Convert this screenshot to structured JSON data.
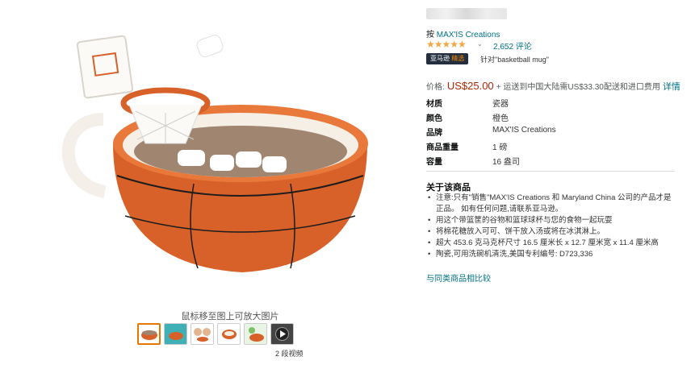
{
  "gallery": {
    "hint": "鼠标移至图上可放大图片",
    "videos_label": "2 段视频",
    "thumbnails": [
      "thumb-mug-front",
      "thumb-mug-lifestyle",
      "thumb-kids",
      "thumb-mug-top",
      "thumb-mug-alt",
      "thumb-video"
    ]
  },
  "product": {
    "brand_prefix": "按",
    "brand": "MAX'IS Creations",
    "rating_stars": "★★★★★",
    "rating_chevron": "⌄",
    "reviews": "2,652 评论",
    "badge_main": "亚马逊",
    "badge_highlight": "精选",
    "badge_for": "针对\"basketball mug\"",
    "price_label": "价格:",
    "price": "US$25.00",
    "shipping": "+ 运送到中国大陆需US$33.30配送和进口费用",
    "details_link": "详情",
    "specs": [
      {
        "key": "材质",
        "value": "瓷器"
      },
      {
        "key": "颜色",
        "value": "橙色"
      },
      {
        "key": "品牌",
        "value": "MAX'IS Creations"
      },
      {
        "key": "商品重量",
        "value": "1 磅"
      },
      {
        "key": "容量",
        "value": "16 盎司"
      }
    ],
    "about_title": "关于该商品",
    "bullets": [
      "注意:只有\"销售\"MAX'IS Creations 和 Maryland China 公司的产品才是正品。 如有任何问题,请联系亚马逊。",
      "用这个带篮筐的谷物和篮球球杯与您的食物一起玩耍",
      "将棉花糖放入可可、饼干放入汤或将在冰淇淋上。",
      "超大 453.6 克马克杯尺寸 16.5 厘米长 x 12.7 厘米宽 x 11.4 厘米高",
      "陶瓷,可用洗碗机清洗,美国专利编号: D723,336"
    ],
    "compare_link": "与同类商品相比较"
  },
  "colors": {
    "price": "#b12704",
    "link": "#007185",
    "star": "#f3a847",
    "mug_orange": "#d8612a"
  }
}
